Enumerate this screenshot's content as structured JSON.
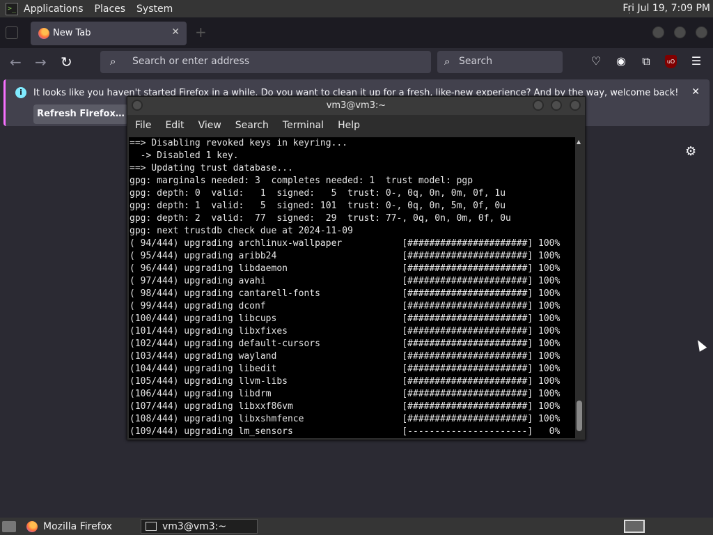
{
  "top_panel": {
    "menus": [
      "Applications",
      "Places",
      "System"
    ],
    "clock": "Fri Jul 19,  7:09 PM"
  },
  "firefox": {
    "tab": {
      "label": "New Tab"
    },
    "urlbar": {
      "placeholder": "Search or enter address"
    },
    "searchbar": {
      "placeholder": "Search"
    },
    "notification": {
      "message": "It looks like you haven't started Firefox in a while. Do you want to clean it up for a fresh, like-new experience? And by the way, welcome back!",
      "button": "Refresh Firefox…"
    }
  },
  "terminal": {
    "title": "vm3@vm3:~",
    "menu": [
      "File",
      "Edit",
      "View",
      "Search",
      "Terminal",
      "Help"
    ],
    "lines": [
      "==> Disabling revoked keys in keyring...",
      "  -> Disabled 1 key.",
      "==> Updating trust database...",
      "gpg: marginals needed: 3  completes needed: 1  trust model: pgp",
      "gpg: depth: 0  valid:   1  signed:   5  trust: 0-, 0q, 0n, 0m, 0f, 1u",
      "gpg: depth: 1  valid:   5  signed: 101  trust: 0-, 0q, 0n, 5m, 0f, 0u",
      "gpg: depth: 2  valid:  77  signed:  29  trust: 77-, 0q, 0n, 0m, 0f, 0u",
      "gpg: next trustdb check due at 2024-11-09",
      "( 94/444) upgrading archlinux-wallpaper           [######################] 100%",
      "( 95/444) upgrading aribb24                       [######################] 100%",
      "( 96/444) upgrading libdaemon                     [######################] 100%",
      "( 97/444) upgrading avahi                         [######################] 100%",
      "( 98/444) upgrading cantarell-fonts               [######################] 100%",
      "( 99/444) upgrading dconf                         [######################] 100%",
      "(100/444) upgrading libcups                       [######################] 100%",
      "(101/444) upgrading libxfixes                     [######################] 100%",
      "(102/444) upgrading default-cursors               [######################] 100%",
      "(103/444) upgrading wayland                       [######################] 100%",
      "(104/444) upgrading libedit                       [######################] 100%",
      "(105/444) upgrading llvm-libs                     [######################] 100%",
      "(106/444) upgrading libdrm                        [######################] 100%",
      "(107/444) upgrading libxxf86vm                    [######################] 100%",
      "(108/444) upgrading libxshmfence                  [######################] 100%",
      "(109/444) upgrading lm_sensors                    [----------------------]   0%"
    ]
  },
  "taskbar": {
    "tasks": [
      "Mozilla Firefox",
      "vm3@vm3:~"
    ]
  },
  "colors": {
    "firefox_bg": "#2b2a33",
    "tab_bg": "#42414d",
    "notif_accent": "#f770ff",
    "info_icon": "#80ebff",
    "terminal_bg": "#000000",
    "ublock": "#800000"
  }
}
